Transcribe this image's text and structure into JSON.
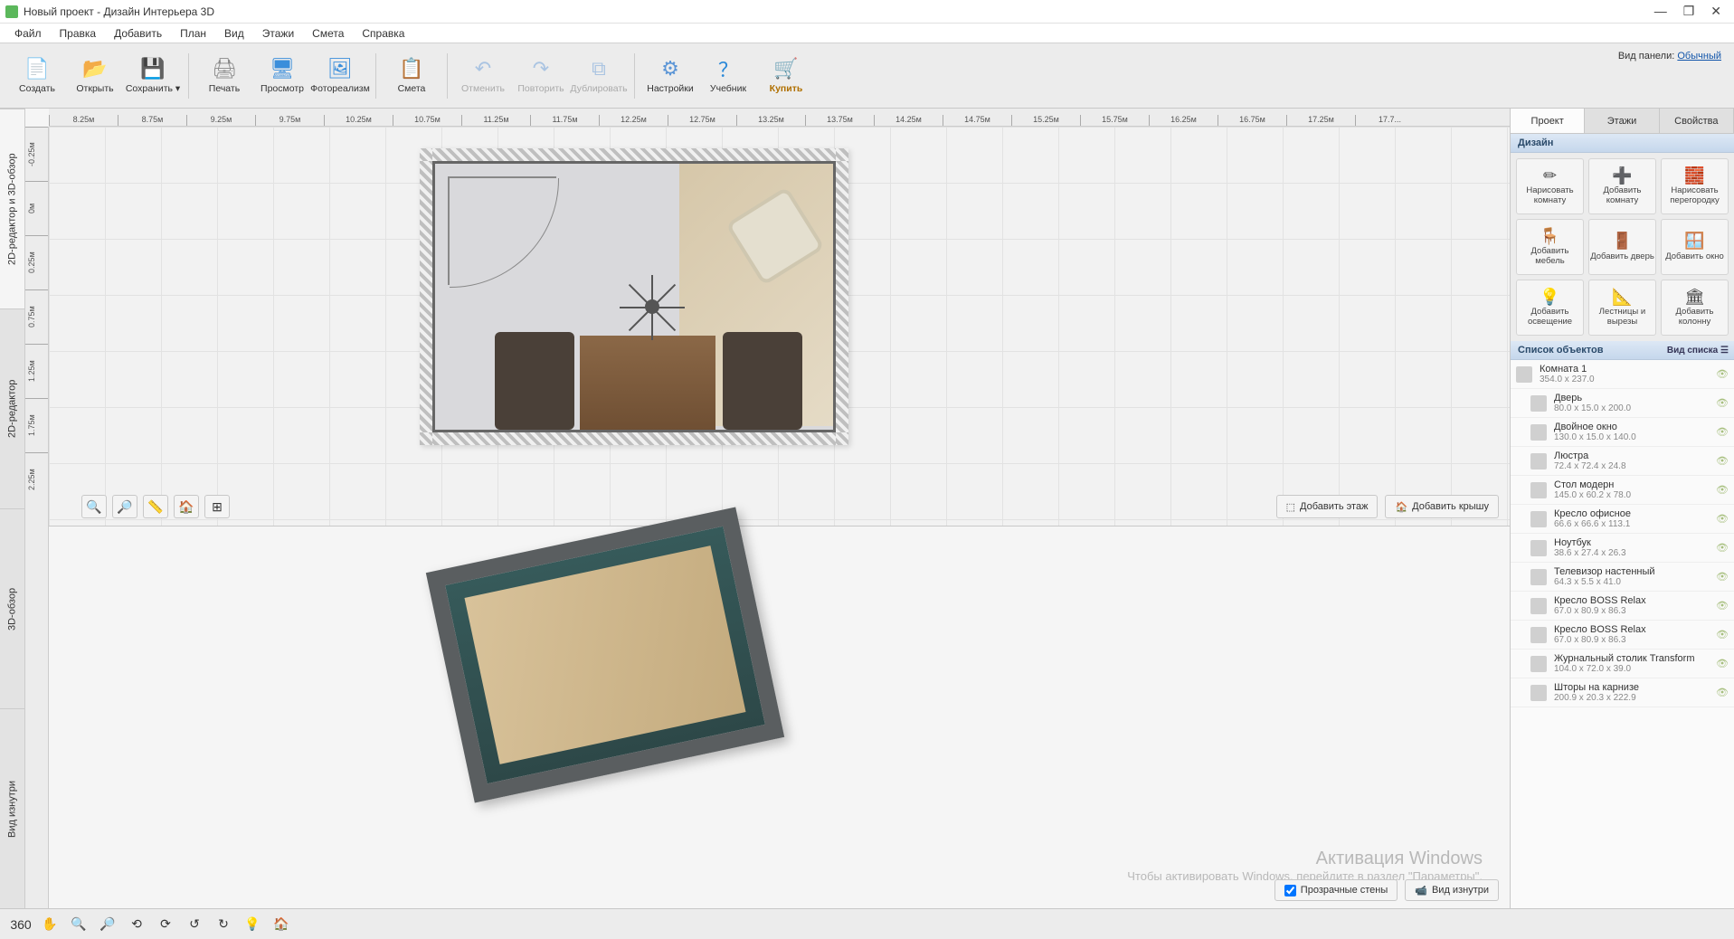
{
  "title": "Новый проект - Дизайн Интерьера 3D",
  "menu": [
    "Файл",
    "Правка",
    "Добавить",
    "План",
    "Вид",
    "Этажи",
    "Смета",
    "Справка"
  ],
  "toolbar": [
    {
      "label": "Создать",
      "icon": "📄",
      "color": "#3a8edb"
    },
    {
      "label": "Открыть",
      "icon": "📂",
      "color": "#e3a93b"
    },
    {
      "label": "Сохранить",
      "icon": "💾",
      "color": "#416fb4",
      "dropdown": true
    },
    {
      "sep": true
    },
    {
      "label": "Печать",
      "icon": "🖨",
      "color": "#888"
    },
    {
      "label": "Просмотр",
      "icon": "🖥",
      "color": "#3a8edb"
    },
    {
      "label": "Фотореализм",
      "icon": "🖼",
      "color": "#3a8edb"
    },
    {
      "sep": true
    },
    {
      "label": "Смета",
      "icon": "📋",
      "color": "#e3a93b"
    },
    {
      "sep": true
    },
    {
      "label": "Отменить",
      "icon": "↶",
      "color": "#5b95d6",
      "disabled": true
    },
    {
      "label": "Повторить",
      "icon": "↷",
      "color": "#5b95d6",
      "disabled": true
    },
    {
      "label": "Дублировать",
      "icon": "⧉",
      "color": "#5b95d6",
      "disabled": true
    },
    {
      "sep": true
    },
    {
      "label": "Настройки",
      "icon": "⚙",
      "color": "#5b95d6"
    },
    {
      "label": "Учебник",
      "icon": "？",
      "color": "#2a88d8"
    },
    {
      "label": "Купить",
      "icon": "🛒",
      "color": "#e3a93b",
      "bold": true
    }
  ],
  "panel_mode": {
    "label": "Вид панели:",
    "value": "Обычный"
  },
  "left_tabs": [
    "2D-редактор и 3D-обзор",
    "2D-редактор",
    "3D-обзор",
    "Вид изнутри"
  ],
  "ruler_h": [
    "8.25м",
    "8.75м",
    "9.25м",
    "9.75м",
    "10.25м",
    "10.75м",
    "11.25м",
    "11.75м",
    "12.25м",
    "12.75м",
    "13.25м",
    "13.75м",
    "14.25м",
    "14.75м",
    "15.25м",
    "15.75м",
    "16.25м",
    "16.75м",
    "17.25м",
    "17.7..."
  ],
  "ruler_v": [
    "-0.25м",
    "0м",
    "0.25м",
    "0.75м",
    "1.25м",
    "1.75м",
    "2.25м"
  ],
  "view2d_buttons": {
    "add_floor": "Добавить этаж",
    "add_roof": "Добавить крышу"
  },
  "view3d": {
    "transparent_walls": "Прозрачные стены",
    "inside_view": "Вид изнутри"
  },
  "watermark": {
    "t1": "Активация Windows",
    "t2": "Чтобы активировать Windows, перейдите в раздел \"Параметры\"."
  },
  "rp_tabs": [
    "Проект",
    "Этажи",
    "Свойства"
  ],
  "rp_design_header": "Дизайн",
  "design_buttons": [
    {
      "label": "Нарисовать комнату",
      "icon": "✏"
    },
    {
      "label": "Добавить комнату",
      "icon": "➕"
    },
    {
      "label": "Нарисовать перегородку",
      "icon": "🧱"
    },
    {
      "label": "Добавить мебель",
      "icon": "🪑"
    },
    {
      "label": "Добавить дверь",
      "icon": "🚪"
    },
    {
      "label": "Добавить окно",
      "icon": "🪟"
    },
    {
      "label": "Добавить освещение",
      "icon": "💡"
    },
    {
      "label": "Лестницы и вырезы",
      "icon": "📐"
    },
    {
      "label": "Добавить колонну",
      "icon": "🏛"
    }
  ],
  "obj_list_header": "Список объектов",
  "obj_view_mode": "Вид списка",
  "objects": [
    {
      "name": "Комната 1",
      "dim": "354.0 x 237.0",
      "root": true
    },
    {
      "name": "Дверь",
      "dim": "80.0 x 15.0 x 200.0"
    },
    {
      "name": "Двойное окно",
      "dim": "130.0 x 15.0 x 140.0"
    },
    {
      "name": "Люстра",
      "dim": "72.4 x 72.4 x 24.8"
    },
    {
      "name": "Стол модерн",
      "dim": "145.0 x 60.2 x 78.0"
    },
    {
      "name": "Кресло офисное",
      "dim": "66.6 x 66.6 x 113.1"
    },
    {
      "name": "Ноутбук",
      "dim": "38.6 x 27.4 x 26.3"
    },
    {
      "name": "Телевизор настенный",
      "dim": "64.3 x 5.5 x 41.0"
    },
    {
      "name": "Кресло BOSS Relax",
      "dim": "67.0 x 80.9 x 86.3"
    },
    {
      "name": "Кресло BOSS Relax",
      "dim": "67.0 x 80.9 x 86.3"
    },
    {
      "name": "Журнальный столик Transform",
      "dim": "104.0 x 72.0 x 39.0"
    },
    {
      "name": "Шторы на карнизе",
      "dim": "200.9 x 20.3 x 222.9"
    }
  ]
}
